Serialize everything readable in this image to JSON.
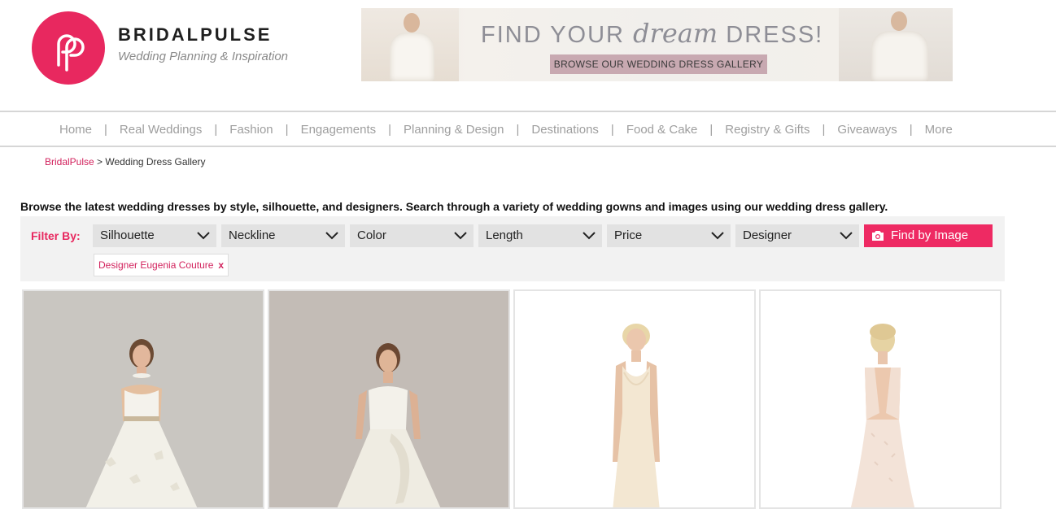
{
  "brand": {
    "name": "BRIDALPULSE",
    "tagline": "Wedding Planning & Inspiration"
  },
  "banner": {
    "headline_prefix": "FIND YOUR ",
    "headline_script": "dream",
    "headline_suffix": " DRESS!",
    "button_label": "BROWSE OUR WEDDING DRESS GALLERY"
  },
  "nav": {
    "items": [
      {
        "label": "Home"
      },
      {
        "label": "Real Weddings"
      },
      {
        "label": "Fashion"
      },
      {
        "label": "Engagements"
      },
      {
        "label": "Planning & Design"
      },
      {
        "label": "Destinations"
      },
      {
        "label": "Food & Cake"
      },
      {
        "label": "Registry & Gifts"
      },
      {
        "label": "Giveaways"
      },
      {
        "label": "More"
      }
    ],
    "separator": "|"
  },
  "breadcrumb": {
    "home": "BridalPulse",
    "separator": " > ",
    "current": "Wedding Dress Gallery"
  },
  "intro": "Browse the latest wedding dresses by style, silhouette, and designers. Search through a variety of wedding gowns and images using our wedding dress gallery.",
  "filters": {
    "label": "Filter By:",
    "selects": [
      {
        "label": "Silhouette"
      },
      {
        "label": "Neckline"
      },
      {
        "label": "Color"
      },
      {
        "label": "Length"
      },
      {
        "label": "Price"
      },
      {
        "label": "Designer"
      }
    ],
    "find_by_image": "Find by Image",
    "active_tags": [
      {
        "label": "Designer Eugenia Couture",
        "remove": "x"
      }
    ]
  },
  "colors": {
    "accent": "#e8285f",
    "nav_text": "#9e9e9e",
    "panel_bg": "#f2f2f2",
    "select_bg": "#e2e2e2"
  },
  "gallery": {
    "items": [
      {
        "icon": "dress-photo-strapless-ballgown"
      },
      {
        "icon": "dress-photo-satin-ballgown"
      },
      {
        "icon": "dress-photo-lace-sheath"
      },
      {
        "icon": "dress-photo-lace-backless"
      }
    ]
  }
}
